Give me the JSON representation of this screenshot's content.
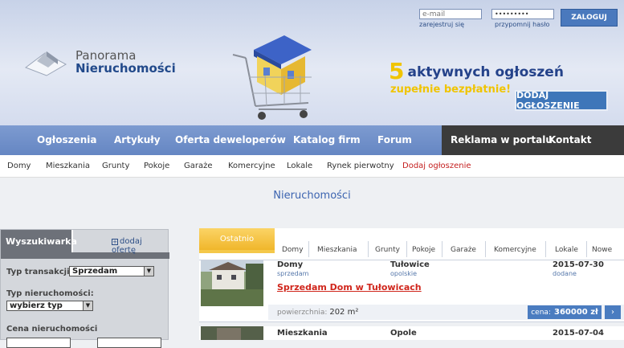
{
  "login": {
    "email_placeholder": "e-mail",
    "password_value": "•••••••••",
    "register_link": "zarejestruj się",
    "remind_link": "przypomnij hasło",
    "login_button": "ZALOGUJ"
  },
  "logo": {
    "line1": "Panorama",
    "line2": "Nieruchomości"
  },
  "promo": {
    "number": "5",
    "line1": "aktywnych ogłoszeń",
    "line2": "zupełnie bezpłatnie!",
    "button": "DODAJ OGŁOSZENIE"
  },
  "nav": {
    "items": [
      "Ogłoszenia",
      "Artykuły",
      "Oferta deweloperów",
      "Katalog firm",
      "Forum"
    ],
    "dark_items": [
      "Reklama w portalu",
      "Kontakt"
    ]
  },
  "subnav": {
    "items": [
      "Domy",
      "Mieszkania",
      "Grunty",
      "Pokoje",
      "Garaże",
      "Komercyjne",
      "Lokale",
      "Rynek pierwotny"
    ],
    "highlight": "Dodaj ogłoszenie"
  },
  "page_title": "Nieruchomości",
  "sidebar": {
    "tab": "Wyszukiwarka",
    "add_offer": "dodaj ofertę",
    "transaction_label": "Typ transakcji:",
    "transaction_value": "Sprzedam",
    "property_label": "Typ nieruchomości:",
    "property_value": "wybierz typ",
    "price_label": "Cena nieruchomości"
  },
  "main_tabs": {
    "active": "Ostatnio",
    "items": [
      "Domy",
      "Mieszkania",
      "Grunty",
      "Pokoje",
      "Garaże",
      "Komercyjne",
      "Lokale",
      "Nowe"
    ]
  },
  "listings": [
    {
      "category": "Domy",
      "type": "sprzedam",
      "city": "Tułowice",
      "region": "opolskie",
      "date": "2015-07-30",
      "date_label": "dodane",
      "title": "Sprzedam Dom w Tułowicach",
      "area_label": "powierzchnia:",
      "area_value": "202 m²",
      "price_label": "cena:",
      "price_value": "360000 zł",
      "more": "›"
    },
    {
      "category": "Mieszkania",
      "city": "Opole",
      "date": "2015-07-04"
    }
  ],
  "colors": {
    "nav": "#7190c9",
    "accent_yellow": "#f0c400",
    "link_red": "#d0261c",
    "brand_blue": "#224a8b"
  }
}
